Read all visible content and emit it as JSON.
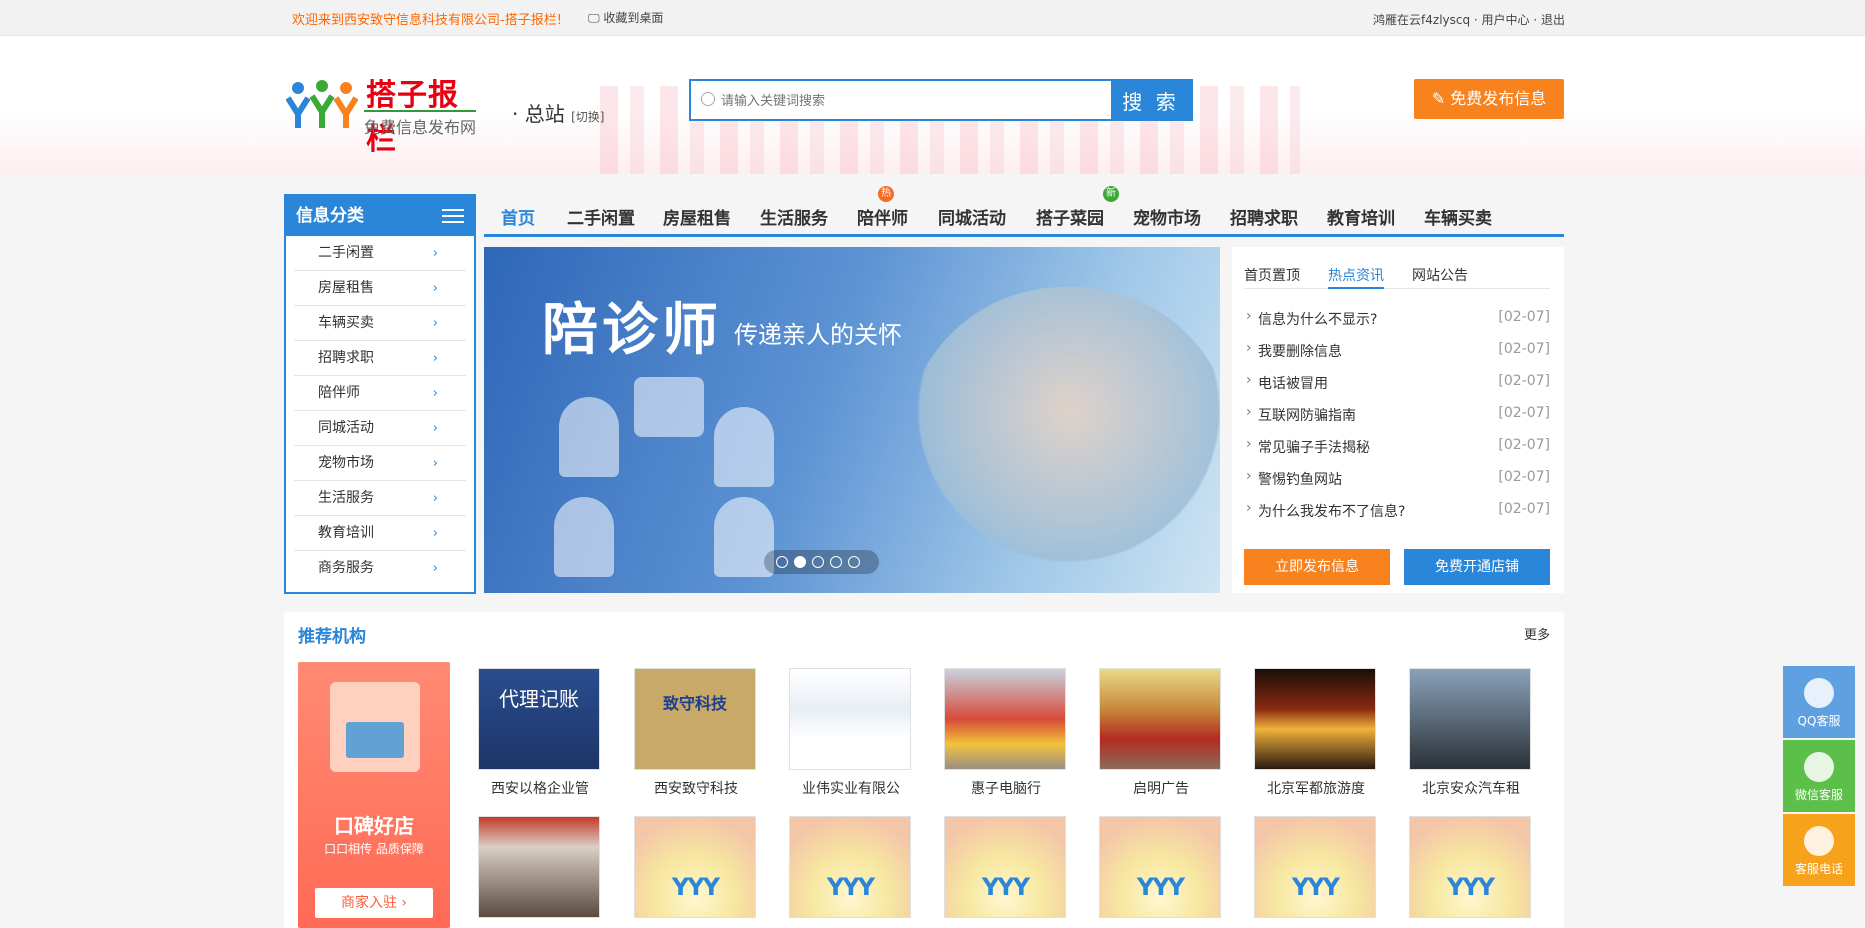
{
  "topbar": {
    "welcome": "欢迎来到西安致守信息科技有限公司-搭子报栏!",
    "favorite": "收藏到桌面",
    "user": "鸿雁在云f4zlyscq · 用户中心 · 退出"
  },
  "header": {
    "logo_title": "搭子报栏",
    "logo_subtitle": "免费信息发布网",
    "station": "· 总站",
    "station_switch": "[切换]",
    "search_placeholder": "请输入关键词搜索",
    "search_button": "搜 索",
    "publish_button": "免费发布信息"
  },
  "category": {
    "title": "信息分类",
    "items": [
      "二手闲置",
      "房屋租售",
      "车辆买卖",
      "招聘求职",
      "陪伴师",
      "同城活动",
      "宠物市场",
      "生活服务",
      "教育培训",
      "商务服务"
    ]
  },
  "nav": {
    "items": [
      {
        "label": "首页",
        "badge": ""
      },
      {
        "label": "二手闲置",
        "badge": ""
      },
      {
        "label": "房屋租售",
        "badge": ""
      },
      {
        "label": "生活服务",
        "badge": ""
      },
      {
        "label": "陪伴师",
        "badge": "热"
      },
      {
        "label": "同城活动",
        "badge": ""
      },
      {
        "label": "搭子菜园",
        "badge": "新"
      },
      {
        "label": "宠物市场",
        "badge": ""
      },
      {
        "label": "招聘求职",
        "badge": ""
      },
      {
        "label": "教育培训",
        "badge": ""
      },
      {
        "label": "车辆买卖",
        "badge": ""
      }
    ],
    "badge_hot_color": "#f36c21",
    "badge_new_color": "#3aaa35"
  },
  "banner": {
    "headline": "陪诊师",
    "tagline": "传递亲人的关怀",
    "slides": 5,
    "active_slide": 2
  },
  "news": {
    "tabs": [
      "首页置顶",
      "热点资讯",
      "网站公告"
    ],
    "active_tab": 2,
    "items": [
      {
        "title": "信息为什么不显示?",
        "date": "[02-07]"
      },
      {
        "title": "我要删除信息",
        "date": "[02-07]"
      },
      {
        "title": "电话被冒用",
        "date": "[02-07]"
      },
      {
        "title": "互联网防骗指南",
        "date": "[02-07]"
      },
      {
        "title": "常见骗子手法揭秘",
        "date": "[02-07]"
      },
      {
        "title": "警惕钓鱼网站",
        "date": "[02-07]"
      },
      {
        "title": "为什么我发布不了信息?",
        "date": "[02-07]"
      }
    ],
    "publish_button": "立即发布信息",
    "shop_button": "免费开通店铺"
  },
  "recommended": {
    "title": "推荐机构",
    "more": "更多",
    "promo_title": "口碑好店",
    "promo_sub": "口口相传 品质保障",
    "promo_button": "商家入驻 ›",
    "cards_row1": [
      "西安以格企业管",
      "西安致守科技",
      "业伟实业有限公",
      "惠子电脑行",
      "启明广告",
      "北京军都旅游度",
      "北京安众汽车租"
    ],
    "card_images_row1": [
      "代理记账",
      "致守科技",
      "",
      "",
      "",
      "",
      ""
    ]
  },
  "side_tools": [
    {
      "label": "QQ客服",
      "color": "#5ea0e0"
    },
    {
      "label": "微信客服",
      "color": "#5cbf4a"
    },
    {
      "label": "客服电话",
      "color": "#f7a21b"
    }
  ],
  "colors": {
    "primary": "#2a86d8",
    "accent": "#f8821e"
  }
}
